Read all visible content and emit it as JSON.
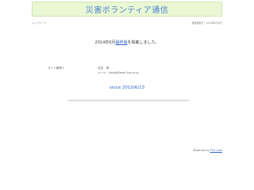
{
  "header": {
    "site_title": "災害ボランティア通信"
  },
  "topbar": {
    "left_text": "トップページ",
    "right_text": "最終更新日：2014年6月4日"
  },
  "notice": {
    "prefix": "2014年6月",
    "link_text": "最終版",
    "suffix": "を掲載しました。"
  },
  "admin": {
    "label": "サイト管理人",
    "name": "石田　博",
    "email": "メール：ishida@mail.fcm.or.jp"
  },
  "since": {
    "text": "since 2010/6/13"
  },
  "footer": {
    "prefix": "Powered by ",
    "link_text": "FC2.com"
  },
  "colors": {
    "banner_bg": "#e9f7d4",
    "title_color": "#4a7fd1",
    "link_color": "#3366cc"
  }
}
